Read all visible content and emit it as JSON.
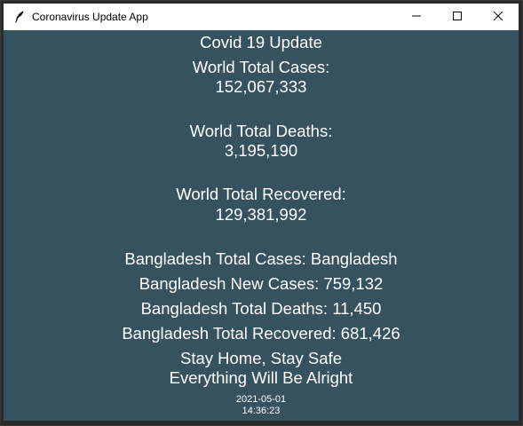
{
  "window": {
    "title": "Coronavirus Update App",
    "icon": "feather-icon",
    "controls": {
      "minimize_icon": "minimize-icon",
      "maximize_icon": "maximize-icon",
      "close_icon": "close-icon"
    }
  },
  "colors": {
    "background": "#36525f",
    "text": "#ffffff",
    "titlebar": "#ffffff"
  },
  "main": {
    "heading": "Covid 19 Update",
    "world_cases_label": "World Total Cases:",
    "world_cases_value": "152,067,333",
    "world_deaths_label": "World Total Deaths:",
    "world_deaths_value": "3,195,190",
    "world_recovered_label": "World Total Recovered:",
    "world_recovered_value": "129,381,992",
    "bd_total_cases": "Bangladesh Total Cases: Bangladesh",
    "bd_new_cases": "Bangladesh New Cases: 759,132",
    "bd_total_deaths": "Bangladesh Total Deaths: 11,450",
    "bd_total_recovered": "Bangladesh Total Recovered: 681,426",
    "message_line1": "Stay Home, Stay Safe",
    "message_line2": "Everything Will Be Alright",
    "date": "2021-05-01",
    "time": "14:36:23"
  }
}
